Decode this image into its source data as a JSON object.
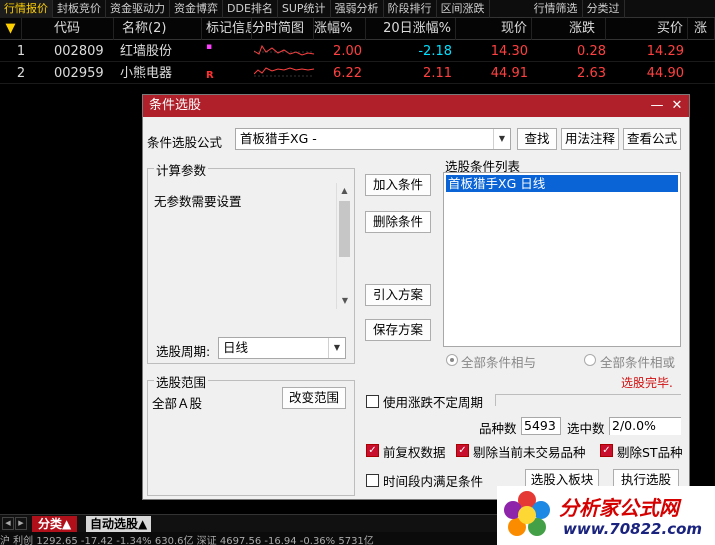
{
  "top_tabs": [
    "行情报价",
    "封板竞价",
    "资金驱动力",
    "资金博弈",
    "DDE排名",
    "SUP统计",
    "强弱分析",
    "阶段排行",
    "区间涨跌",
    "行情筛选",
    "分类过"
  ],
  "grid": {
    "columns": [
      "代码",
      "名称(2)",
      "标记信息",
      "分时简图",
      "涨幅%",
      "20日涨幅%",
      "现价",
      "涨跌",
      "买价",
      "涨"
    ],
    "rows": [
      {
        "idx": "1",
        "code": "002809",
        "name": "红墙股份",
        "mark": "▪",
        "change_pct": "2.00",
        "change20": "-2.18",
        "price": "14.30",
        "delta": "0.28",
        "bid": "14.29"
      },
      {
        "idx": "2",
        "code": "002959",
        "name": "小熊电器",
        "mark": "R",
        "change_pct": "6.22",
        "change20": "2.11",
        "price": "44.91",
        "delta": "2.63",
        "bid": "44.90"
      }
    ]
  },
  "dialog": {
    "title": "条件选股",
    "formula_label": "条件选股公式",
    "formula_value": "首板猎手XG  -",
    "btn_find": "查找",
    "btn_usage": "用法注释",
    "btn_view": "查看公式",
    "calc_params_title": "计算参数",
    "no_params": "无参数需要设置",
    "period_label": "选股周期:",
    "period_value": "日线",
    "btn_add": "加入条件",
    "btn_delete": "删除条件",
    "btn_import": "引入方案",
    "btn_save": "保存方案",
    "cond_list_title": "选股条件列表",
    "cond_items": [
      "首板猎手XG  日线"
    ],
    "radio_and": "全部条件相与",
    "radio_or": "全部条件相或",
    "status": "选股完毕.",
    "scope_title": "选股范围",
    "scope_value": "全部Ａ股",
    "btn_change_scope": "改变范围",
    "use_period": "使用涨跌不定周期",
    "count_label": "品种数",
    "count_value": "5493",
    "selected_label": "选中数",
    "selected_value": "2/0.0%",
    "cb_fq": "前复权数据",
    "cb_exclude_notrade": "剔除当前未交易品种",
    "cb_exclude_st": "剔除ST品种",
    "cb_time": "时间段内满足条件",
    "btn_to_block": "选股入板块",
    "btn_execute": "执行选股"
  },
  "bottom_tabs": [
    "分类▲",
    "自动选股▲"
  ],
  "status_text": "沪 利创 1292.65  -17.42  -1.34%  630.6亿  深证 4697.56  -16.94  -0.36%  5731亿",
  "logo": {
    "title": "分析家公式网",
    "url": "www.70822.com"
  },
  "colors": {
    "title_bar": "#b0202a",
    "up": "#ff4040",
    "down": "#00e0ff",
    "selected": "#0a64d6"
  }
}
